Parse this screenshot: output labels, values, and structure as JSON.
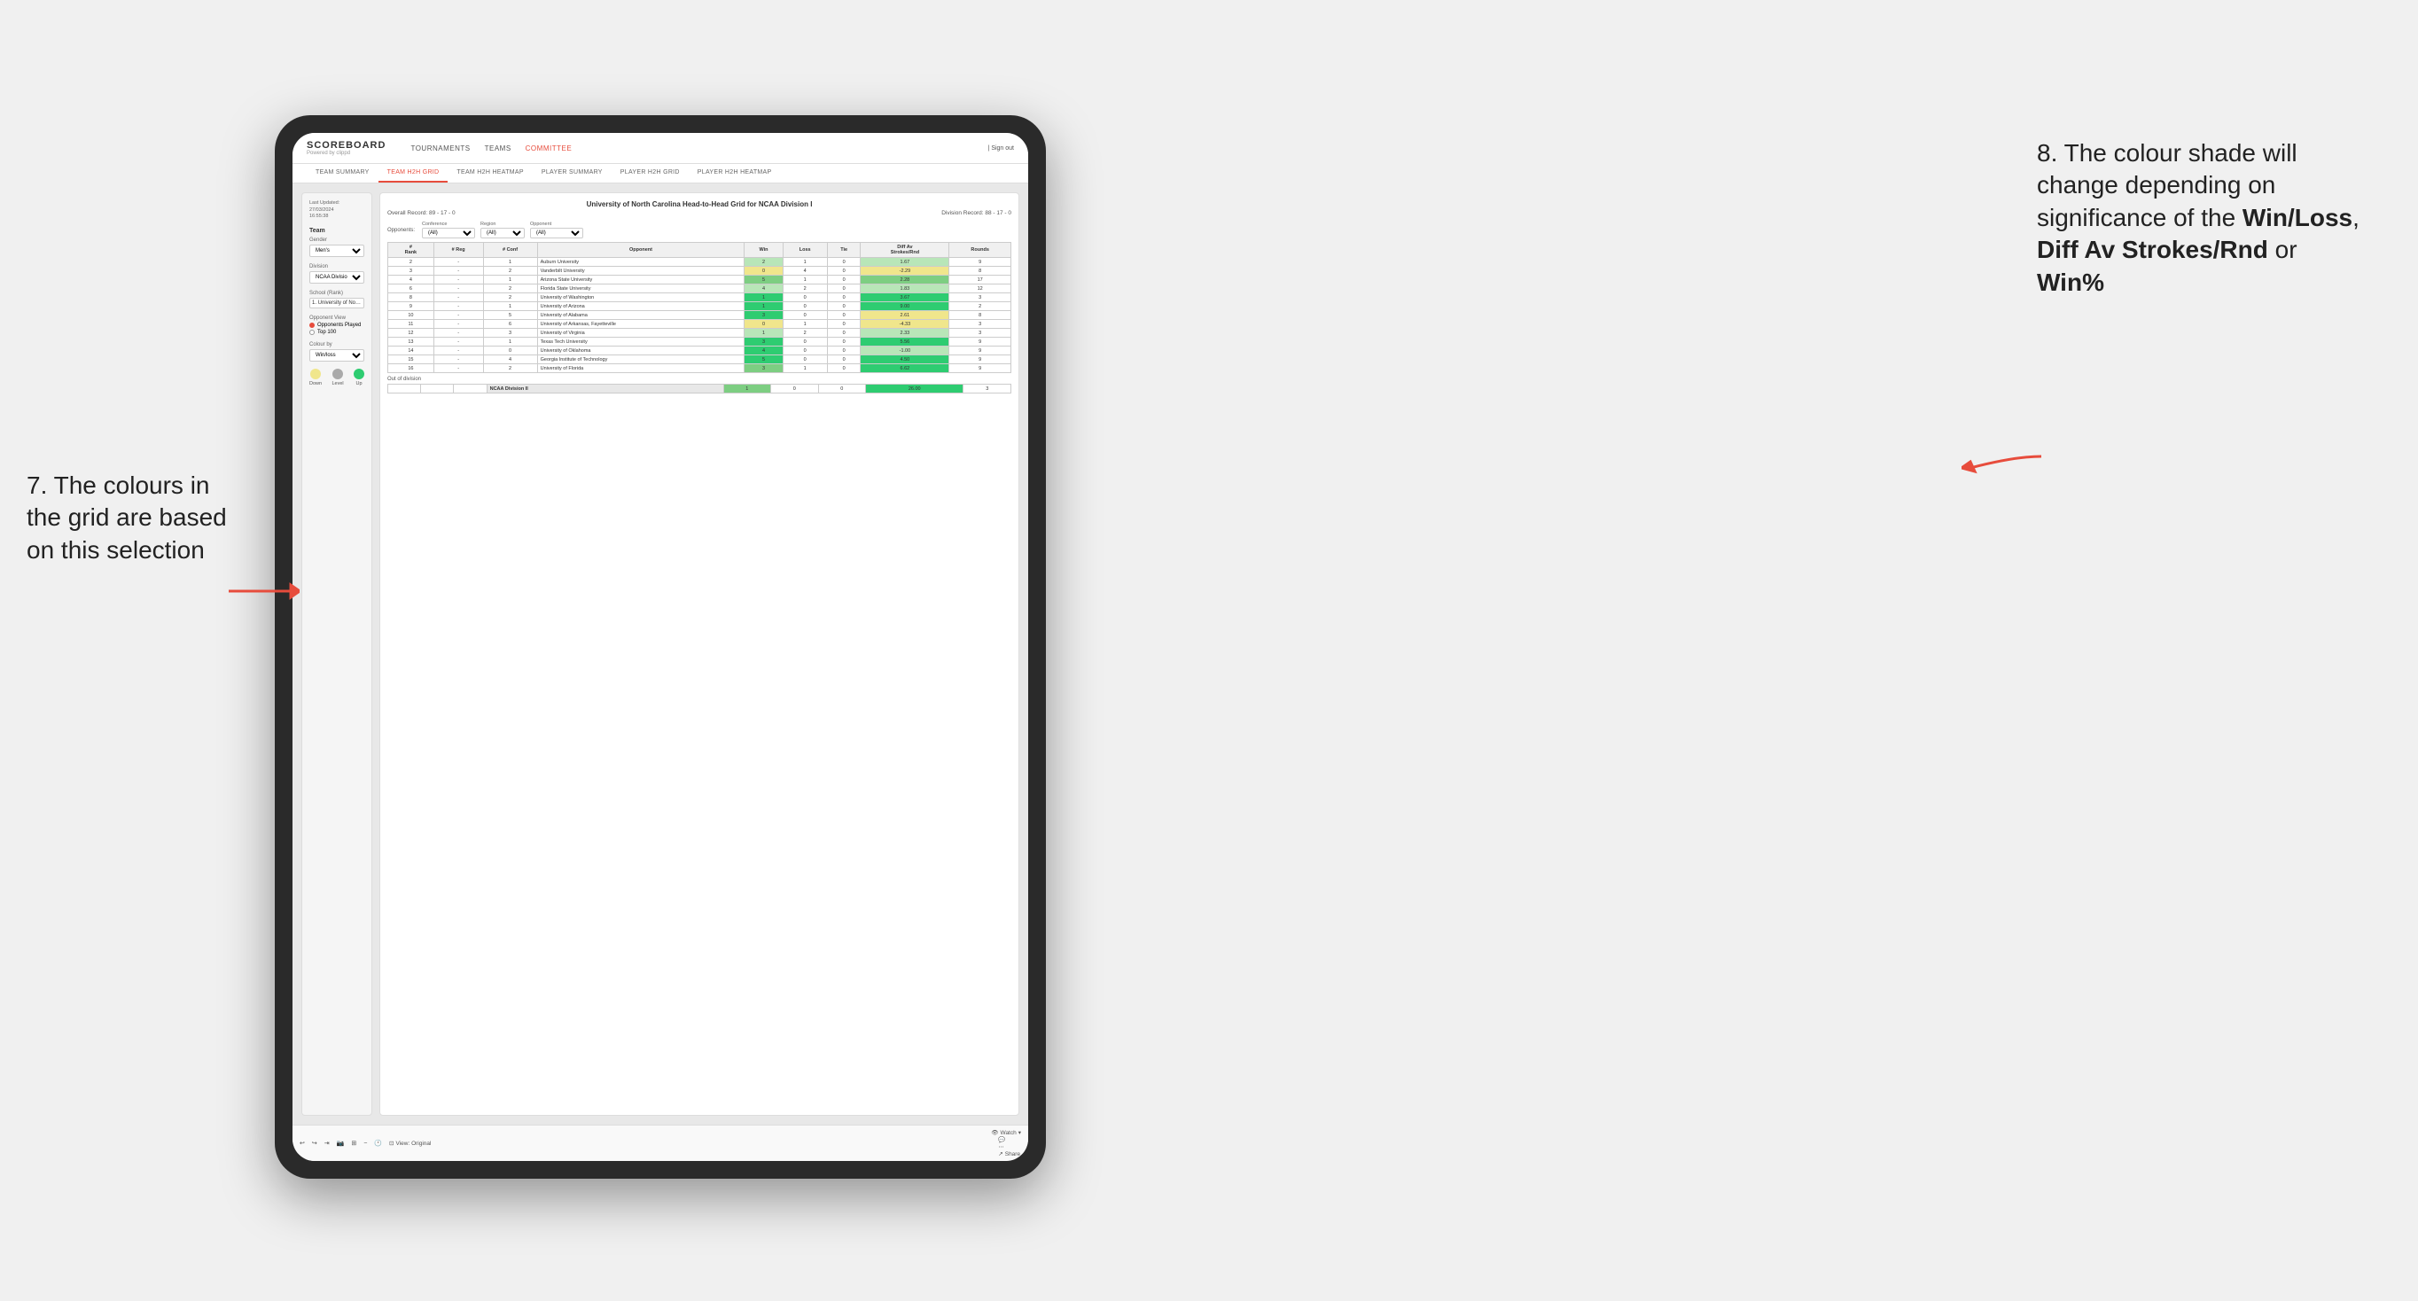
{
  "annotations": {
    "left_title": "7. The colours in the grid are based on this selection",
    "right_title": "8. The colour shade will change depending on significance of the",
    "right_bold1": "Win/Loss",
    "right_comma": ", ",
    "right_bold2": "Diff Av Strokes/Rnd",
    "right_or": " or ",
    "right_bold3": "Win%"
  },
  "header": {
    "logo": "SCOREBOARD",
    "logo_sub": "Powered by clippd",
    "nav": [
      "TOURNAMENTS",
      "TEAMS",
      "COMMITTEE"
    ],
    "sign_out": "Sign out"
  },
  "sub_nav": {
    "items": [
      "TEAM SUMMARY",
      "TEAM H2H GRID",
      "TEAM H2H HEATMAP",
      "PLAYER SUMMARY",
      "PLAYER H2H GRID",
      "PLAYER H2H HEATMAP"
    ],
    "active": "TEAM H2H GRID"
  },
  "sidebar": {
    "last_updated": "Last Updated: 27/03/2024\n16:55:38",
    "team_section": "Team",
    "gender_label": "Gender",
    "gender_value": "Men's",
    "division_label": "Division",
    "division_value": "NCAA Division I",
    "school_label": "School (Rank)",
    "school_value": "1. University of Nort...",
    "opponent_view_label": "Opponent View",
    "opponent_options": [
      "Opponents Played",
      "Top 100"
    ],
    "opponent_selected": "Opponents Played",
    "colour_by_label": "Colour by",
    "colour_by_value": "Win/loss",
    "legend": {
      "down_label": "Down",
      "level_label": "Level",
      "up_label": "Up"
    }
  },
  "grid": {
    "title": "University of North Carolina Head-to-Head Grid for NCAA Division I",
    "overall_record_label": "Overall Record:",
    "overall_record": "89 - 17 - 0",
    "division_record_label": "Division Record:",
    "division_record": "88 - 17 - 0",
    "filters": {
      "opponents_label": "Opponents:",
      "conference_label": "Conference",
      "conference_value": "(All)",
      "region_label": "Region",
      "region_value": "(All)",
      "opponent_label": "Opponent",
      "opponent_value": "(All)"
    },
    "columns": [
      "#\nRank",
      "# Reg",
      "# Conf",
      "Opponent",
      "Win",
      "Loss",
      "Tie",
      "Diff Av\nStrokes/Rnd",
      "Rounds"
    ],
    "rows": [
      {
        "rank": "2",
        "reg": "-",
        "conf": "1",
        "opponent": "Auburn University",
        "win": 2,
        "loss": 1,
        "tie": 0,
        "diff": "1.67",
        "rounds": 9,
        "win_color": "green-light",
        "diff_color": "green-light"
      },
      {
        "rank": "3",
        "reg": "-",
        "conf": "2",
        "opponent": "Vanderbilt University",
        "win": 0,
        "loss": 4,
        "tie": 0,
        "diff": "-2.29",
        "rounds": 8,
        "win_color": "yellow",
        "diff_color": "yellow"
      },
      {
        "rank": "4",
        "reg": "-",
        "conf": "1",
        "opponent": "Arizona State University",
        "win": 5,
        "loss": 1,
        "tie": 0,
        "diff": "2.28",
        "rounds": 17,
        "win_color": "green-mid",
        "diff_color": "green-mid"
      },
      {
        "rank": "6",
        "reg": "-",
        "conf": "2",
        "opponent": "Florida State University",
        "win": 4,
        "loss": 2,
        "tie": 0,
        "diff": "1.83",
        "rounds": 12,
        "win_color": "green-light",
        "diff_color": "green-light"
      },
      {
        "rank": "8",
        "reg": "-",
        "conf": "2",
        "opponent": "University of Washington",
        "win": 1,
        "loss": 0,
        "tie": 0,
        "diff": "3.67",
        "rounds": 3,
        "win_color": "green-dark",
        "diff_color": "green-dark"
      },
      {
        "rank": "9",
        "reg": "-",
        "conf": "1",
        "opponent": "University of Arizona",
        "win": 1,
        "loss": 0,
        "tie": 0,
        "diff": "9.00",
        "rounds": 2,
        "win_color": "green-dark",
        "diff_color": "green-dark"
      },
      {
        "rank": "10",
        "reg": "-",
        "conf": "5",
        "opponent": "University of Alabama",
        "win": 3,
        "loss": 0,
        "tie": 0,
        "diff": "2.61",
        "rounds": 8,
        "win_color": "green-dark",
        "diff_color": "yellow"
      },
      {
        "rank": "11",
        "reg": "-",
        "conf": "6",
        "opponent": "University of Arkansas, Fayetteville",
        "win": 0,
        "loss": 1,
        "tie": 0,
        "diff": "-4.33",
        "rounds": 3,
        "win_color": "yellow",
        "diff_color": "yellow"
      },
      {
        "rank": "12",
        "reg": "-",
        "conf": "3",
        "opponent": "University of Virginia",
        "win": 1,
        "loss": 2,
        "tie": 0,
        "diff": "2.33",
        "rounds": 3,
        "win_color": "green-light",
        "diff_color": "green-light"
      },
      {
        "rank": "13",
        "reg": "-",
        "conf": "1",
        "opponent": "Texas Tech University",
        "win": 3,
        "loss": 0,
        "tie": 0,
        "diff": "5.56",
        "rounds": 9,
        "win_color": "green-dark",
        "diff_color": "green-dark"
      },
      {
        "rank": "14",
        "reg": "-",
        "conf": "0",
        "opponent": "University of Oklahoma",
        "win": 4,
        "loss": 0,
        "tie": 0,
        "diff": "-1.00",
        "rounds": 9,
        "win_color": "green-dark",
        "diff_color": "green-light"
      },
      {
        "rank": "15",
        "reg": "-",
        "conf": "4",
        "opponent": "Georgia Institute of Technology",
        "win": 5,
        "loss": 0,
        "tie": 0,
        "diff": "4.50",
        "rounds": 9,
        "win_color": "green-dark",
        "diff_color": "green-dark"
      },
      {
        "rank": "16",
        "reg": "-",
        "conf": "2",
        "opponent": "University of Florida",
        "win": 3,
        "loss": 1,
        "tie": 0,
        "diff": "6.62",
        "rounds": 9,
        "win_color": "green-mid",
        "diff_color": "green-dark"
      }
    ],
    "out_of_division": {
      "label": "Out of division",
      "rows": [
        {
          "name": "NCAA Division II",
          "win": 1,
          "loss": 0,
          "tie": 0,
          "diff": "26.00",
          "rounds": 3,
          "diff_color": "green-dark"
        }
      ]
    }
  },
  "toolbar": {
    "view_label": "View: Original",
    "watch_label": "Watch",
    "share_label": "Share"
  }
}
